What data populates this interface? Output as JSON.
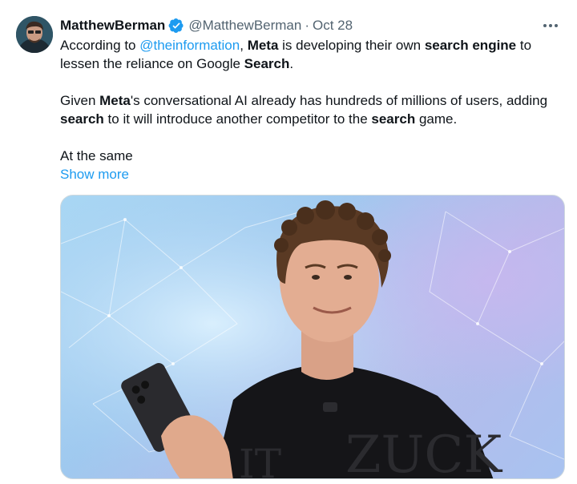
{
  "tweet": {
    "author_name": "MatthewBerman",
    "handle": "@MatthewBerman",
    "separator": "·",
    "date": "Oct 28",
    "paragraph1": {
      "t1": "According to ",
      "mention": "@theinformation",
      "t2": ", ",
      "b1": "Meta",
      "t3": " is developing their own ",
      "b2": "search engine",
      "t4": " to lessen the reliance on Google ",
      "b3": "Search",
      "t5": "."
    },
    "paragraph2": {
      "t1": "Given ",
      "b1": "Meta",
      "t2": "'s conversational AI already has hundreds of millions of users, adding ",
      "b2": "search",
      "t3": " to it will introduce another competitor to the ",
      "b3": "search",
      "t4": " game."
    },
    "paragraph3": "At the same",
    "show_more": "Show more",
    "media": {
      "shirt_text": "ZUCK",
      "shirt_text_left": "IT"
    }
  },
  "colors": {
    "accent": "#1d9bf0",
    "secondary_text": "#536471",
    "primary_text": "#0f1419"
  },
  "icons": [
    "avatar",
    "verified-badge-icon",
    "more-options-icon"
  ]
}
